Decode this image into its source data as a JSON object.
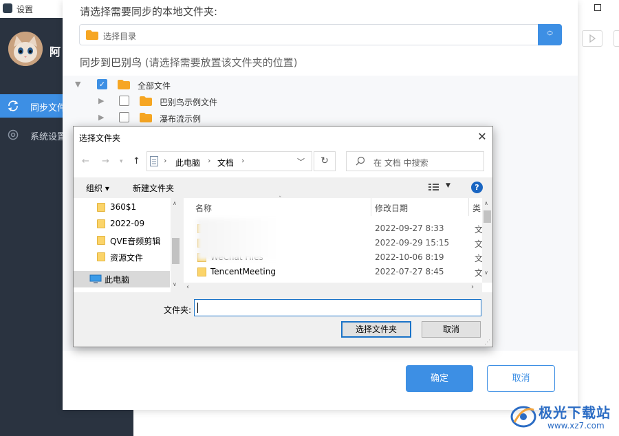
{
  "window": {
    "title": "设置"
  },
  "sidebar": {
    "username": "阿",
    "items": [
      {
        "label": "同步文件",
        "active": true
      },
      {
        "label": "系统设置",
        "active": false
      }
    ]
  },
  "sync_modal": {
    "heading": "请选择需要同步的本地文件夹:",
    "dir_placeholder": "选择目录",
    "sync_to": "同步到巴别鸟",
    "sync_to_hint": "(请选择需要放置该文件夹的位置)",
    "tree": [
      {
        "label": "全部文件",
        "checked": true
      },
      {
        "label": "巴别鸟示例文件",
        "checked": false
      },
      {
        "label": "瀑布流示例",
        "checked": false
      }
    ],
    "ok_label": "确定",
    "cancel_label": "取消"
  },
  "dialog": {
    "title": "选择文件夹",
    "breadcrumbs": [
      "此电脑",
      "文档"
    ],
    "search_placeholder": "在 文档 中搜索",
    "organize_label": "组织 ▾",
    "new_folder_label": "新建文件夹",
    "nav_items": [
      {
        "label": "360$1"
      },
      {
        "label": "2022-09"
      },
      {
        "label": "QVE音频剪辑"
      },
      {
        "label": "资源文件"
      },
      {
        "label": "此电脑"
      }
    ],
    "columns": {
      "name": "名称",
      "date": "修改日期",
      "type": "类"
    },
    "files": [
      {
        "name": "",
        "date": "2022-09-27 8:33",
        "type": "文"
      },
      {
        "name": "",
        "date": "2022-09-29 15:15",
        "type": "文"
      },
      {
        "name": "WeChat Files",
        "date": "2022-10-06 8:19",
        "type": "文"
      },
      {
        "name": "TencentMeeting",
        "date": "2022-07-27 8:45",
        "type": "文"
      }
    ],
    "folder_label": "文件夹:",
    "folder_value": "",
    "select_button": "选择文件夹",
    "cancel_button": "取消"
  },
  "watermark": {
    "name": "极光下载站",
    "url": "www.xz7.com"
  },
  "colors": {
    "accent": "#3d8fe4",
    "sidebar_bg": "#2a3340",
    "win_focus": "#1a73c8"
  }
}
